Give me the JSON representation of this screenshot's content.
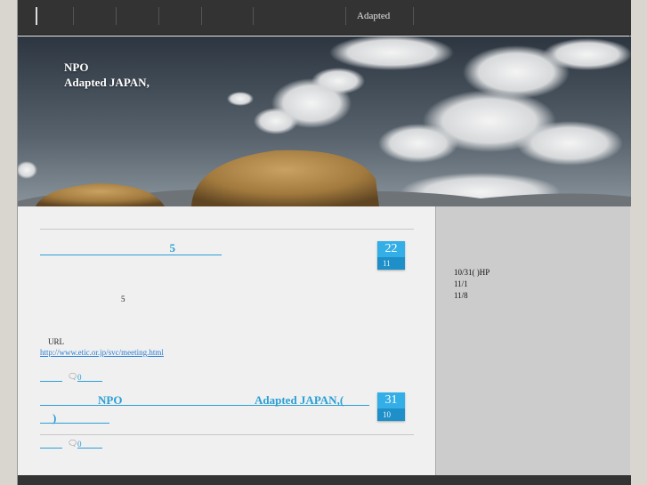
{
  "nav": {
    "items": [
      "Adapted"
    ]
  },
  "hero": {
    "title_line1": "NPO",
    "title_line2": "Adapted JAPAN,"
  },
  "posts": [
    {
      "title": "5",
      "day": "22",
      "month": "11",
      "body_number": "5",
      "url_label": "URL",
      "url": "http://www.etic.or.jp/svc/meeting.html",
      "comments": "0"
    },
    {
      "title_part1": "NPO",
      "title_part2": "Adapted JAPAN,(",
      "title_part3": ")",
      "day": "31",
      "month": "10",
      "comments": "0"
    }
  ],
  "sidebar": {
    "lines": [
      "10/31( )HP",
      "11/1",
      "11/8"
    ]
  },
  "icons": {
    "comment": "comment-icon"
  },
  "colors": {
    "accent": "#2a9fd6",
    "nav_bg": "#333333",
    "sidebar_bg": "#cccccc"
  }
}
